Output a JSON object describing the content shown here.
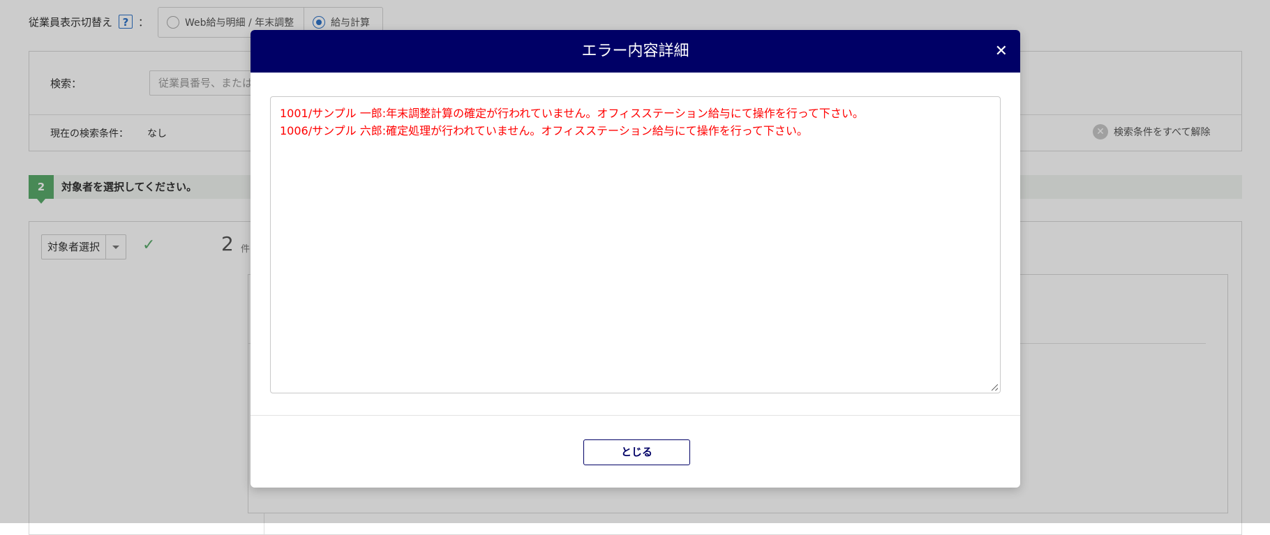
{
  "background": {
    "display_toggle": {
      "label": "従業員表示切替え",
      "help_text": "?",
      "colon": "：",
      "options": [
        {
          "label": "Web給与明細 / 年末調整",
          "selected": false
        },
        {
          "label": "給与計算",
          "selected": true
        }
      ]
    },
    "search": {
      "label": "検索：",
      "placeholder": "従業員番号、または"
    },
    "current_conditions": {
      "label": "現在の検索条件：",
      "value": "なし",
      "clear_all_label": "検索条件をすべて解除"
    },
    "step": {
      "number": "2",
      "text": "対象者を選択してください。"
    },
    "target_select": {
      "label": "対象者選択",
      "count": "2",
      "count_unit": "件"
    }
  },
  "modal": {
    "title": "エラー内容詳細",
    "close_icon": "close-icon",
    "errors": [
      "1001/サンプル 一郎:年末調整計算の確定が行われていません。オフィスステーション給与にて操作を行って下さい。",
      "1006/サンプル 六郎:確定処理が行われていません。オフィスステーション給与にて操作を行って下さい。"
    ],
    "close_button_label": "とじる"
  },
  "colors": {
    "header_bg": "#000066",
    "error_text": "#ff0000",
    "step_green": "#5aac6c",
    "radio_blue": "#2f74c8",
    "check_green": "#5aac6c"
  }
}
